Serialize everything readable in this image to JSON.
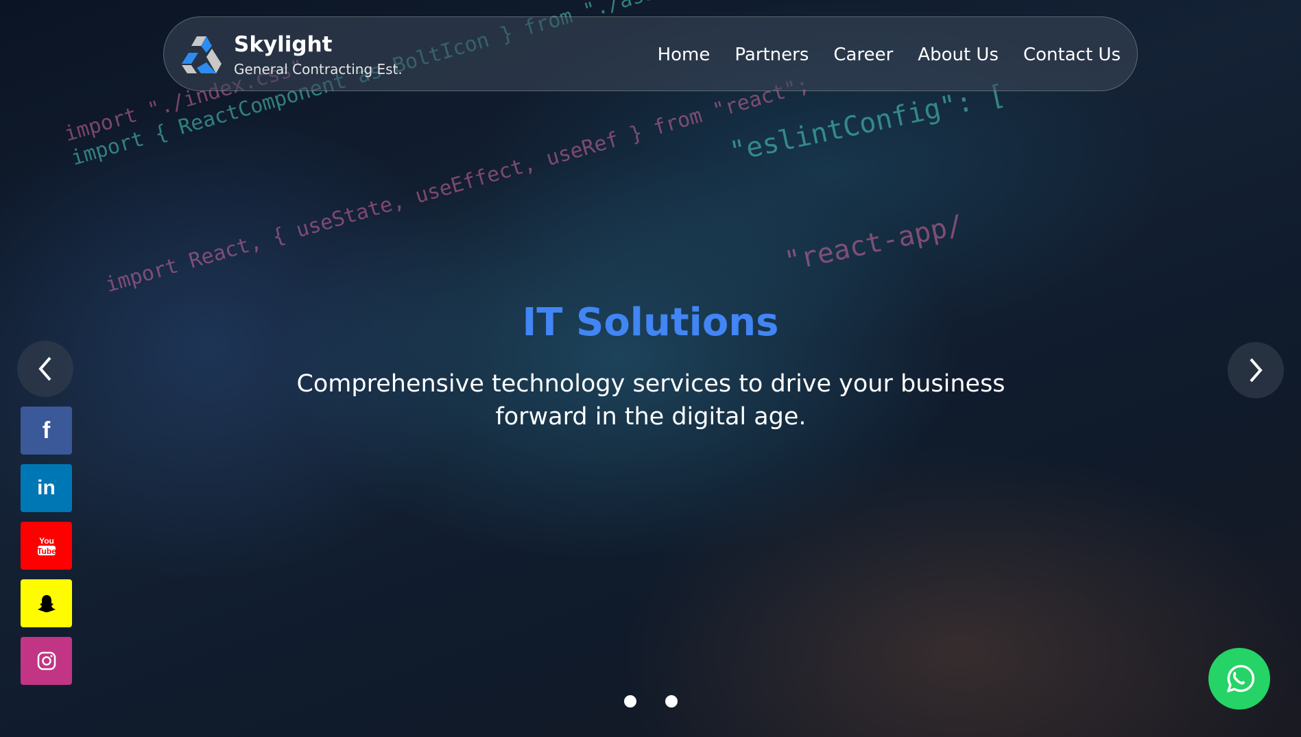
{
  "brand": {
    "name": "Skylight",
    "tagline": "General Contracting Est."
  },
  "nav": {
    "items": [
      "Home",
      "Partners",
      "Career",
      "About Us",
      "Contact Us"
    ]
  },
  "hero": {
    "title": "IT Solutions",
    "subtitle": "Comprehensive technology services to drive your business forward in the digital age."
  },
  "social": [
    {
      "name": "facebook",
      "color": "#3b5998"
    },
    {
      "name": "linkedin",
      "color": "#0077b5"
    },
    {
      "name": "youtube",
      "color": "#ff0000"
    },
    {
      "name": "snapchat",
      "color": "#fffc00"
    },
    {
      "name": "instagram",
      "color": "#c13584"
    }
  ],
  "slider": {
    "slides": 2,
    "active": 1
  },
  "colors": {
    "accent": "#4285f4",
    "whatsapp": "#25d366"
  }
}
